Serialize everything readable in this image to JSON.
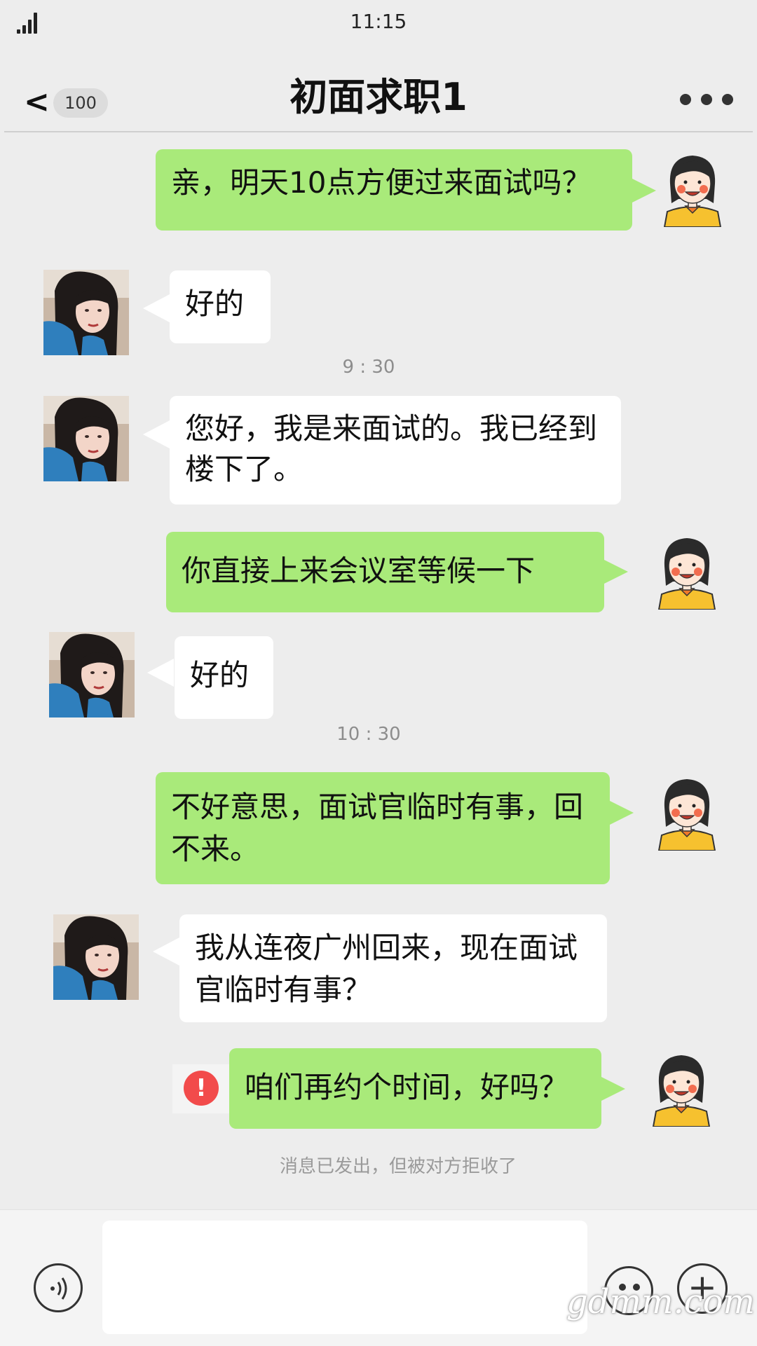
{
  "status_bar": {
    "time": "11:15"
  },
  "header": {
    "back_symbol": "<",
    "unread_count": "100",
    "title": "初面求职1",
    "more_icon": "ellipsis-icon"
  },
  "messages": [
    {
      "side": "right",
      "text": "亲，明天10点方便过来面试吗？"
    },
    {
      "side": "left",
      "text": "好的"
    },
    {
      "side": "left",
      "text": "您好，我是来面试的。我已经到楼下了。"
    },
    {
      "side": "right",
      "text": "你直接上来会议室等候一下"
    },
    {
      "side": "left",
      "text": "好的"
    },
    {
      "side": "right",
      "text": "不好意思，面试官临时有事，回不来。"
    },
    {
      "side": "left",
      "text": "我从连夜广州回来，现在面试官临时有事？"
    },
    {
      "side": "right",
      "text": "咱们再约个时间，好吗？",
      "failed": true
    }
  ],
  "timestamps": [
    "9 : 30",
    "10 : 30"
  ],
  "system_note": "消息已发出，但被对方拒收了",
  "error_icon_symbol": "!",
  "input_bar": {
    "voice_icon": "voice-icon",
    "emoji_icon": "emoji-icon",
    "plus_symbol": "+",
    "input_value": ""
  },
  "watermark": "gdmm.com",
  "colors": {
    "sent_bubble": "#a9ea7a",
    "received_bubble": "#ffffff",
    "background": "#ededed",
    "error": "#f24b4b"
  }
}
